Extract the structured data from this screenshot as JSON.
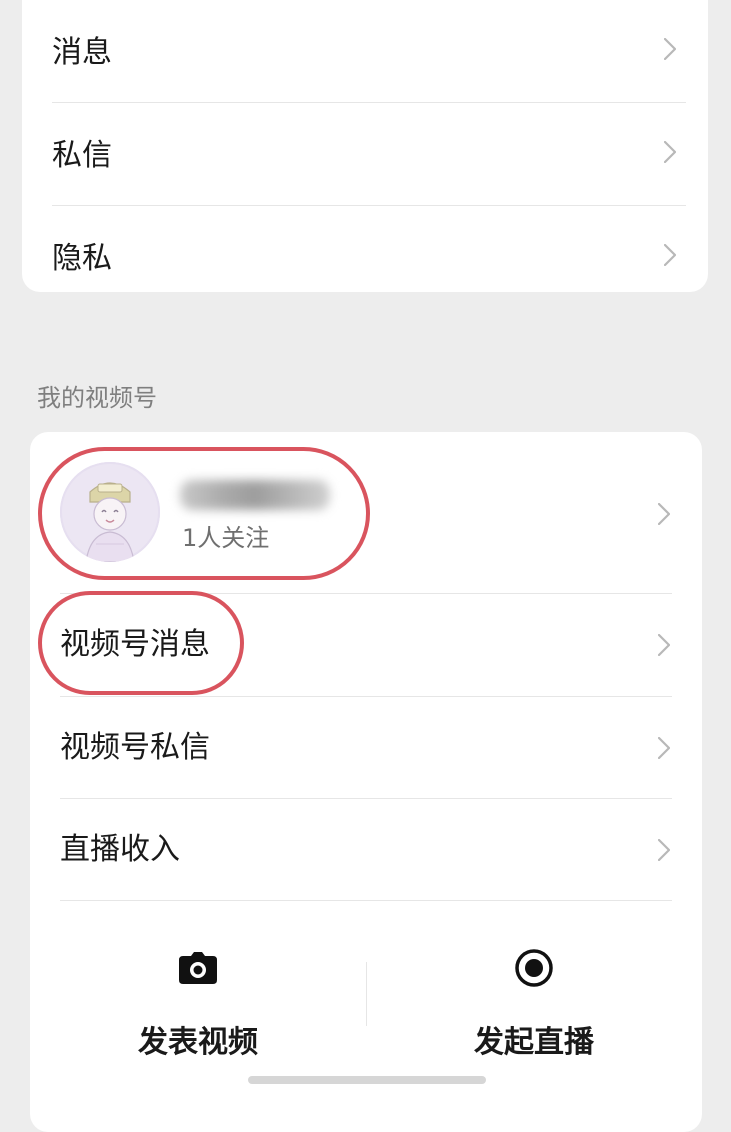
{
  "top_menu": {
    "items": [
      {
        "label": "消息"
      },
      {
        "label": "私信"
      },
      {
        "label": "隐私"
      }
    ]
  },
  "channel_section": {
    "title": "我的视频号",
    "profile": {
      "followers": "1人关注"
    },
    "items": [
      {
        "label": "视频号消息"
      },
      {
        "label": "视频号私信"
      },
      {
        "label": "直播收入"
      }
    ],
    "actions": [
      {
        "label": "发表视频",
        "icon": "camera-icon"
      },
      {
        "label": "发起直播",
        "icon": "live-record-icon"
      }
    ]
  },
  "colors": {
    "page_bg": "#ededed",
    "card_bg": "#ffffff",
    "highlight": "#d9545e",
    "secondary_text": "#7f7f7f"
  }
}
